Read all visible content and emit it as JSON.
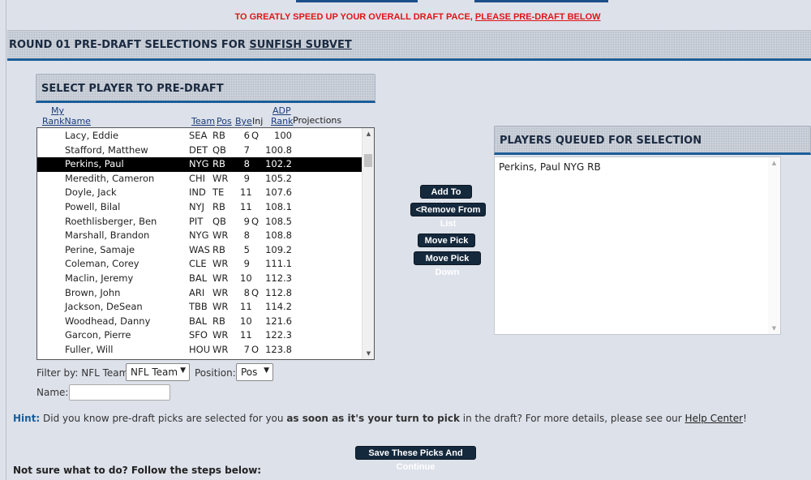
{
  "banner": {
    "message": "TO GREATLY SPEED UP YOUR OVERALL DRAFT PACE, ",
    "link": "PLEASE PRE-DRAFT BELOW"
  },
  "round": {
    "title_prefix": "ROUND 01 PRE-DRAFT SELECTIONS FOR ",
    "team": "SUNFISH SUBVET"
  },
  "select_panel": {
    "title": "SELECT PLAYER TO PRE-DRAFT",
    "headers": {
      "my_rank_top": "My",
      "my_rank_bottom": "Rank",
      "name": "Name",
      "team": "Team",
      "pos": "Pos",
      "bye": "Bye",
      "inj": "Inj",
      "adp_top": "ADP",
      "adp_bottom": "Rank",
      "projections": "Projections"
    },
    "players": [
      {
        "name": "Lacy, Eddie",
        "team": "SEA",
        "pos": "RB",
        "bye": "6",
        "inj": "Q",
        "adp": "100",
        "selected": false
      },
      {
        "name": "Stafford, Matthew",
        "team": "DET",
        "pos": "QB",
        "bye": "7",
        "inj": "",
        "adp": "100.8",
        "selected": false
      },
      {
        "name": "Perkins, Paul",
        "team": "NYG",
        "pos": "RB",
        "bye": "8",
        "inj": "",
        "adp": "102.2",
        "selected": true
      },
      {
        "name": "Meredith, Cameron",
        "team": "CHI",
        "pos": "WR",
        "bye": "9",
        "inj": "",
        "adp": "105.2",
        "selected": false
      },
      {
        "name": "Doyle, Jack",
        "team": "IND",
        "pos": "TE",
        "bye": "11",
        "inj": "",
        "adp": "107.6",
        "selected": false
      },
      {
        "name": "Powell, Bilal",
        "team": "NYJ",
        "pos": "RB",
        "bye": "11",
        "inj": "",
        "adp": "108.1",
        "selected": false
      },
      {
        "name": "Roethlisberger, Ben",
        "team": "PIT",
        "pos": "QB",
        "bye": "9",
        "inj": "Q",
        "adp": "108.5",
        "selected": false
      },
      {
        "name": "Marshall, Brandon",
        "team": "NYG",
        "pos": "WR",
        "bye": "8",
        "inj": "",
        "adp": "108.8",
        "selected": false
      },
      {
        "name": "Perine, Samaje",
        "team": "WAS",
        "pos": "RB",
        "bye": "5",
        "inj": "",
        "adp": "109.2",
        "selected": false
      },
      {
        "name": "Coleman, Corey",
        "team": "CLE",
        "pos": "WR",
        "bye": "9",
        "inj": "",
        "adp": "111.1",
        "selected": false
      },
      {
        "name": "Maclin, Jeremy",
        "team": "BAL",
        "pos": "WR",
        "bye": "10",
        "inj": "",
        "adp": "112.3",
        "selected": false
      },
      {
        "name": "Brown, John",
        "team": "ARI",
        "pos": "WR",
        "bye": "8",
        "inj": "Q",
        "adp": "112.8",
        "selected": false
      },
      {
        "name": "Jackson, DeSean",
        "team": "TBB",
        "pos": "WR",
        "bye": "11",
        "inj": "",
        "adp": "114.2",
        "selected": false
      },
      {
        "name": "Woodhead, Danny",
        "team": "BAL",
        "pos": "RB",
        "bye": "10",
        "inj": "",
        "adp": "121.6",
        "selected": false
      },
      {
        "name": "Garcon, Pierre",
        "team": "SFO",
        "pos": "WR",
        "bye": "11",
        "inj": "",
        "adp": "122.3",
        "selected": false
      },
      {
        "name": "Fuller, Will",
        "team": "HOU",
        "pos": "WR",
        "bye": "7",
        "inj": "O",
        "adp": "123.8",
        "selected": false
      }
    ]
  },
  "buttons": {
    "add": "Add To List>",
    "remove": "<Remove From List",
    "move_up": "Move Pick Up",
    "move_down": "Move Pick Down",
    "save": "Save These Picks And Continue"
  },
  "queue_panel": {
    "title": "PLAYERS QUEUED FOR SELECTION",
    "items": [
      "Perkins, Paul NYG RB"
    ]
  },
  "filters": {
    "label": "Filter by: NFL Team:",
    "team_value": "NFL Team",
    "position_label": "Position:",
    "position_value": "Pos",
    "name_label": "Name:",
    "name_value": ""
  },
  "hint": {
    "label": "Hint:",
    "text1": " Did you know pre-draft picks are selected for you ",
    "bold": "as soon as it's your turn to pick",
    "text2": " in the draft? For more details, please see our ",
    "link": "Help Center",
    "text3": "!"
  },
  "footer": {
    "not_sure": "Not sure what to do? Follow the steps below:"
  },
  "colors": {
    "accent": "#1c5d98",
    "button": "#15293d",
    "alert": "#e01515",
    "background": "#dde1ea"
  }
}
